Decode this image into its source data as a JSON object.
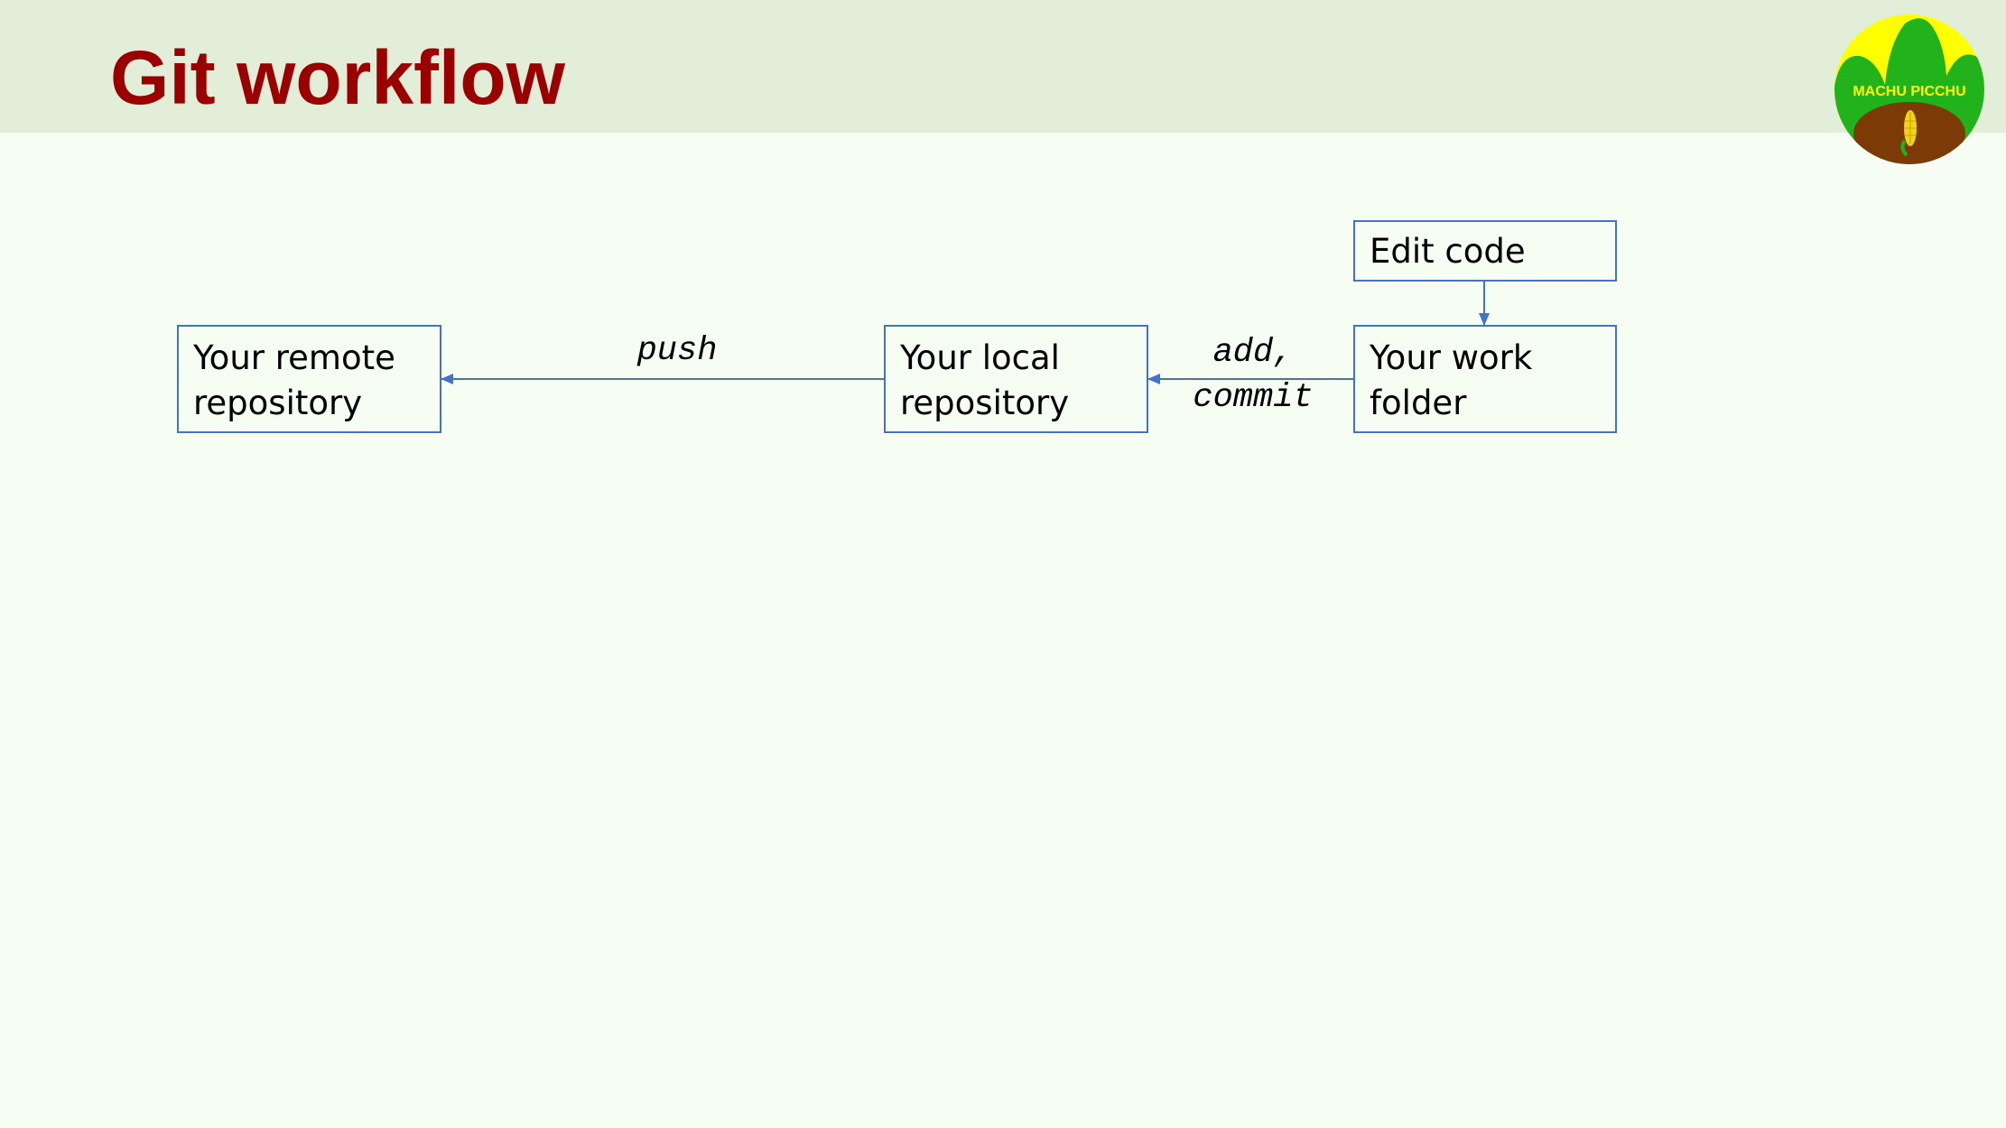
{
  "slide": {
    "title": "Git workflow"
  },
  "logo": {
    "text": "MACHU PICCHU",
    "colors": {
      "sun": "#ffff00",
      "mountain": "#22b21b",
      "ground": "#7b3a06",
      "corn": "#f3d21a"
    }
  },
  "diagram": {
    "nodes": {
      "remote_repo": "Your remote\nrepository",
      "local_repo": "Your local\nrepository",
      "work_folder": "Your work\nfolder",
      "edit_code": "Edit code"
    },
    "edges": {
      "push": "push",
      "add_commit": "add,\ncommit"
    },
    "colors": {
      "box_border": "#4472c4",
      "arrow": "#4472c4"
    }
  }
}
